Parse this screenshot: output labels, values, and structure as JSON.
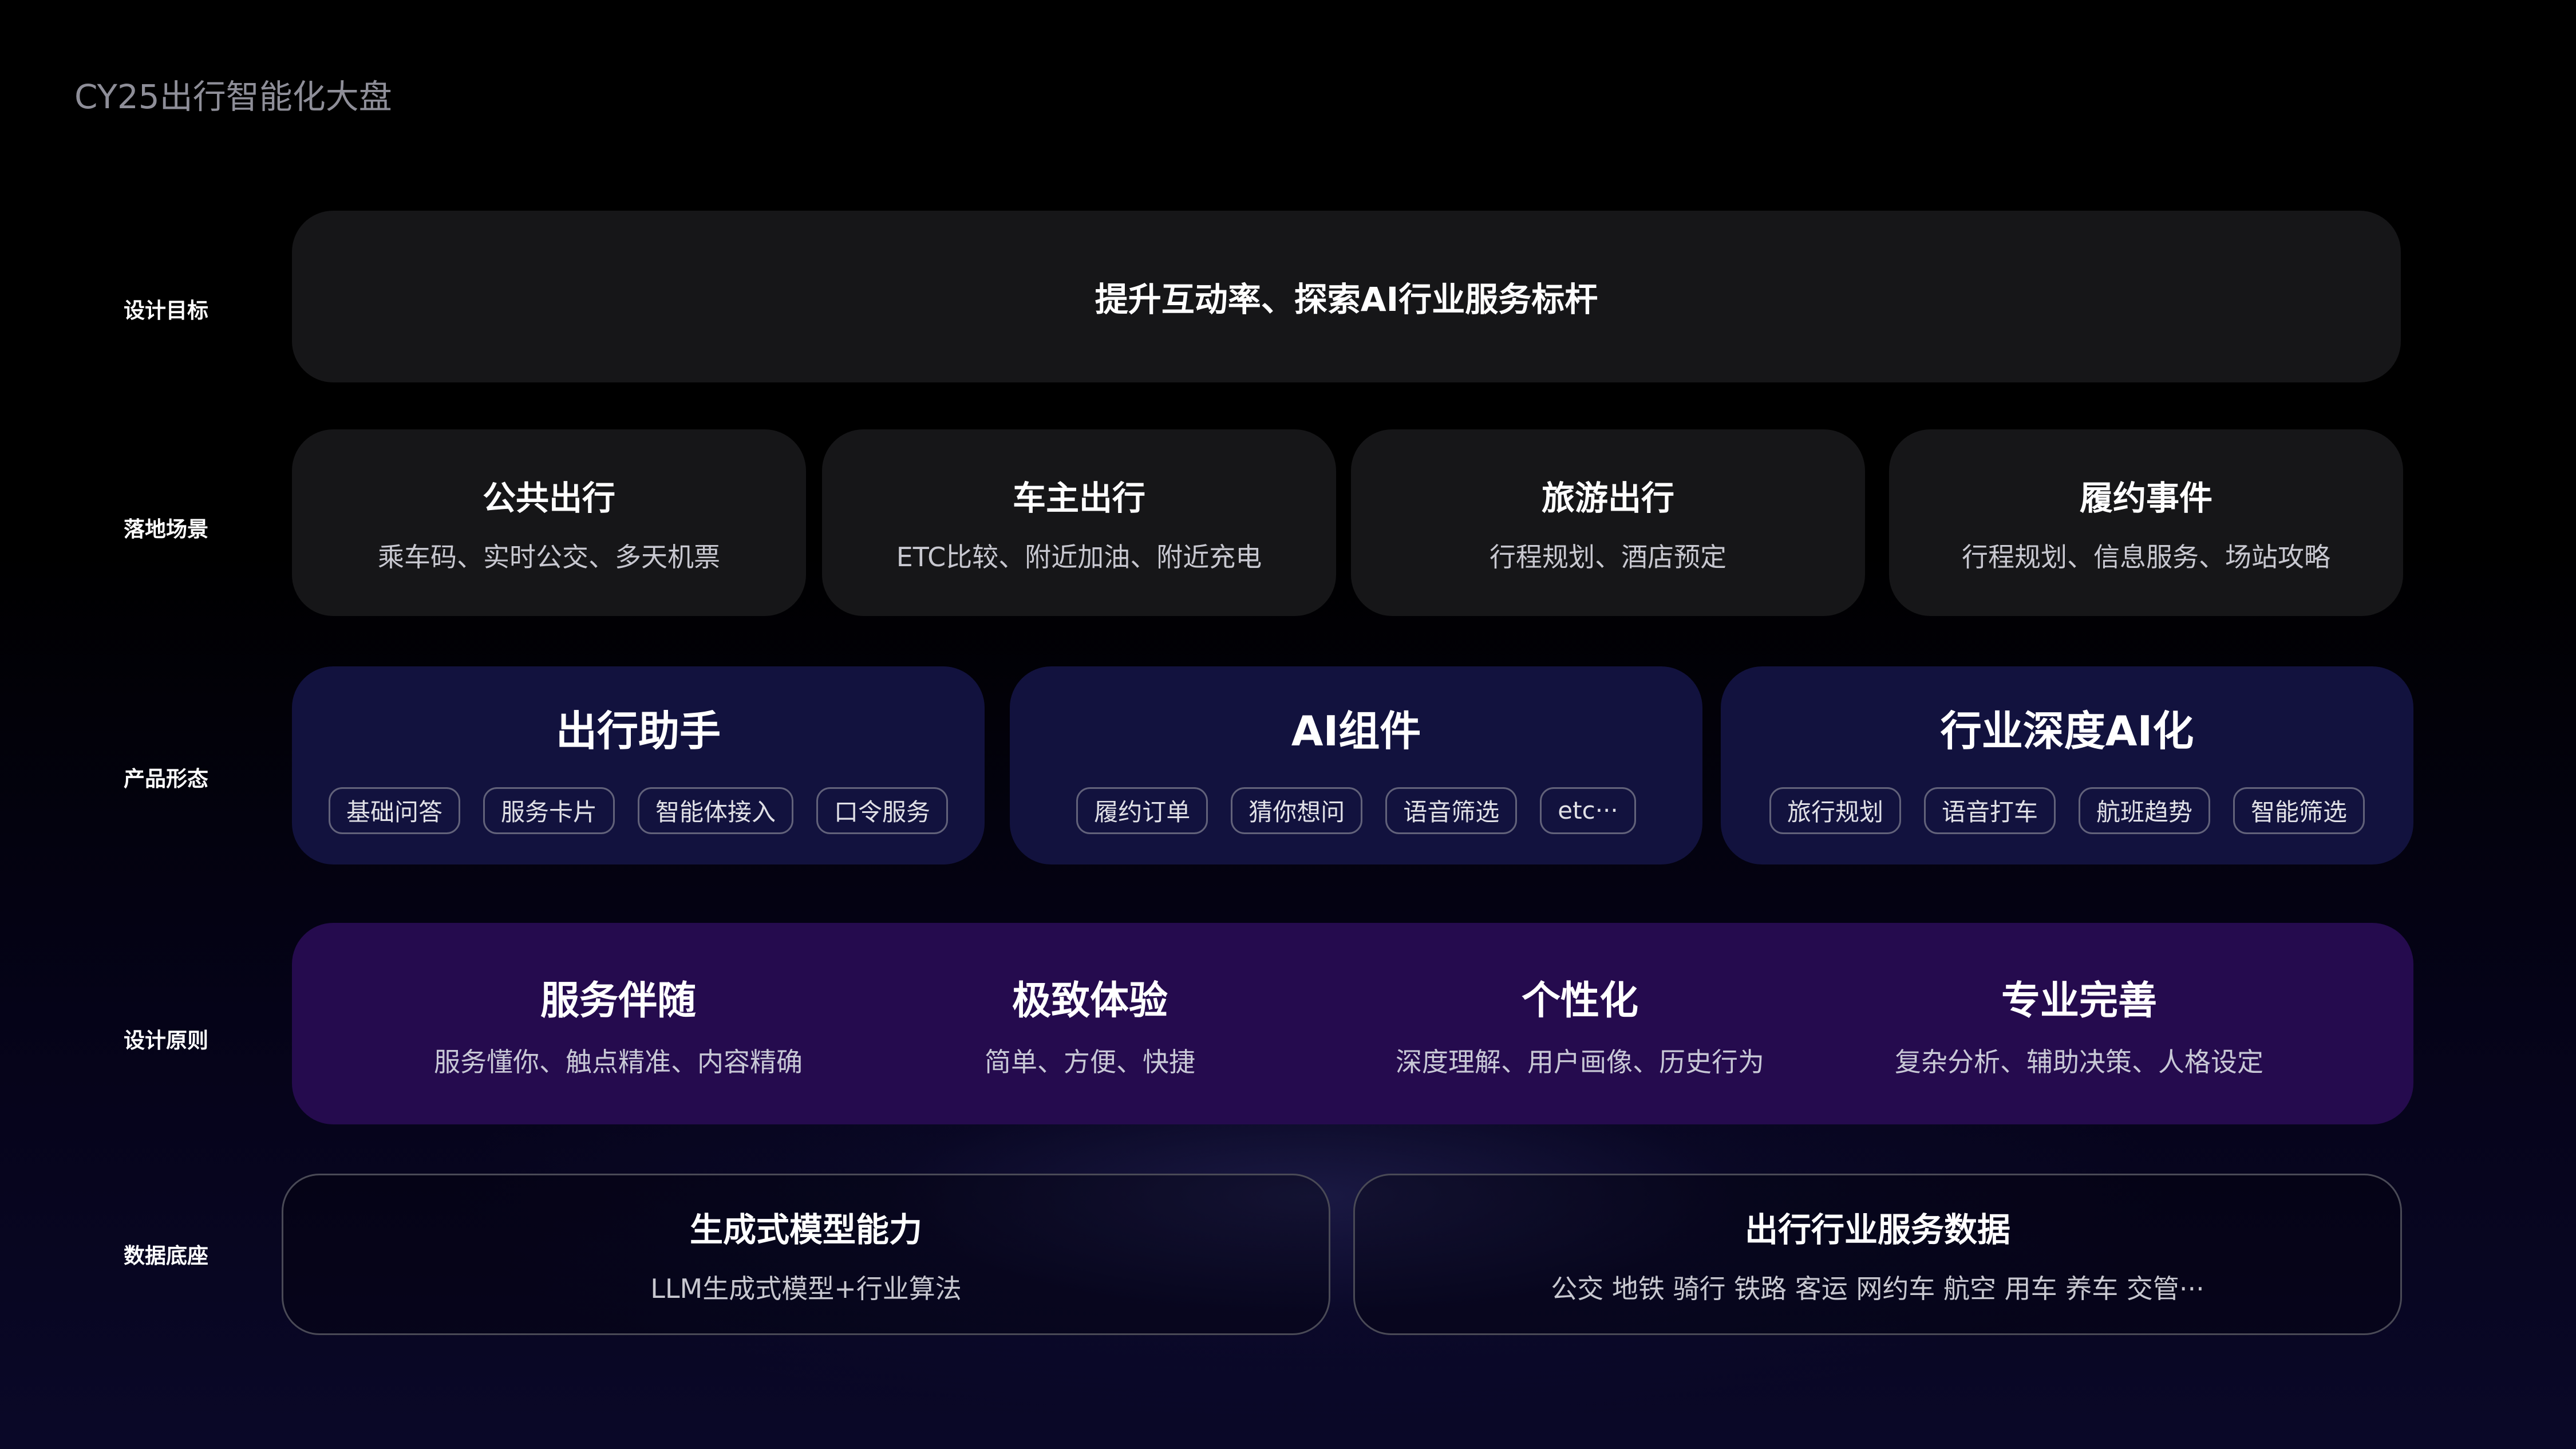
{
  "page_title": "CY25出行智能化大盘",
  "rows": {
    "goal": {
      "label": "设计目标",
      "text": "提升互动率、探索AI行业服务标杆"
    },
    "scenes": {
      "label": "落地场景",
      "items": [
        {
          "title": "公共出行",
          "subtitle": "乘车码、实时公交、多天机票"
        },
        {
          "title": "车主出行",
          "subtitle": "ETC比较、附近加油、附近充电"
        },
        {
          "title": "旅游出行",
          "subtitle": "行程规划、酒店预定"
        },
        {
          "title": "履约事件",
          "subtitle": "行程规划、信息服务、场站攻略"
        }
      ]
    },
    "product_forms": {
      "label": "产品形态",
      "items": [
        {
          "title": "出行助手",
          "tags": [
            "基础问答",
            "服务卡片",
            "智能体接入",
            "口令服务"
          ]
        },
        {
          "title": "AI组件",
          "tags": [
            "履约订单",
            "猜你想问",
            "语音筛选",
            "etc···"
          ]
        },
        {
          "title": "行业深度AI化",
          "tags": [
            "旅行规划",
            "语音打车",
            "航班趋势",
            "智能筛选"
          ]
        }
      ]
    },
    "principles": {
      "label": "设计原则",
      "items": [
        {
          "title": "服务伴随",
          "subtitle": "服务懂你、触点精准、内容精确"
        },
        {
          "title": "极致体验",
          "subtitle": "简单、方便、快捷"
        },
        {
          "title": "个性化",
          "subtitle": "深度理解、用户画像、历史行为"
        },
        {
          "title": "专业完善",
          "subtitle": "复杂分析、辅助决策、人格设定"
        }
      ]
    },
    "data_base": {
      "label": "数据底座",
      "items": [
        {
          "title": "生成式模型能力",
          "subtitle": "LLM生成式模型+行业算法"
        },
        {
          "title": "出行行业服务数据",
          "subtitle": "公交 地铁 骑行 铁路 客运 网约车 航空 用车 养车 交管···"
        }
      ]
    }
  }
}
